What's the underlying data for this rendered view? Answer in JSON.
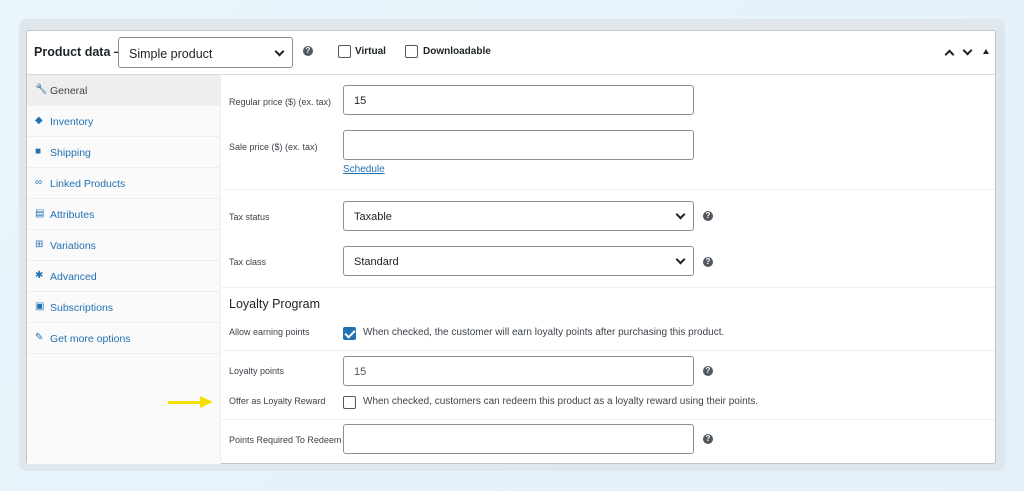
{
  "header": {
    "title": "Product data —",
    "product_type": "Simple product",
    "virtual_label": "Virtual",
    "virtual_checked": false,
    "downloadable_label": "Downloadable",
    "downloadable_checked": false
  },
  "sidebar": {
    "items": [
      {
        "label": "General",
        "icon": "wrench-icon",
        "glyph": "🔧",
        "active": true
      },
      {
        "label": "Inventory",
        "icon": "tag-icon",
        "glyph": "◆",
        "active": false
      },
      {
        "label": "Shipping",
        "icon": "truck-icon",
        "glyph": "■",
        "active": false
      },
      {
        "label": "Linked Products",
        "icon": "link-icon",
        "glyph": "∞",
        "active": false
      },
      {
        "label": "Attributes",
        "icon": "list-icon",
        "glyph": "▤",
        "active": false
      },
      {
        "label": "Variations",
        "icon": "grid-icon",
        "glyph": "⊞",
        "active": false
      },
      {
        "label": "Advanced",
        "icon": "gear-icon",
        "glyph": "✱",
        "active": false
      },
      {
        "label": "Subscriptions",
        "icon": "calendar-icon",
        "glyph": "▣",
        "active": false
      },
      {
        "label": "Get more options",
        "icon": "plugin-icon",
        "glyph": "✎",
        "active": false
      }
    ]
  },
  "general": {
    "regular_price_label": "Regular price ($) (ex. tax)",
    "regular_price_value": "15",
    "sale_price_label": "Sale price ($) (ex. tax)",
    "sale_price_value": "",
    "schedule_link": "Schedule",
    "tax_status_label": "Tax status",
    "tax_status_value": "Taxable",
    "tax_class_label": "Tax class",
    "tax_class_value": "Standard"
  },
  "loyalty": {
    "section_title": "Loyalty Program",
    "allow_earning_label": "Allow earning points",
    "allow_earning_checked": true,
    "allow_earning_desc": "When checked, the customer will earn loyalty points after purchasing this product.",
    "loyalty_points_label": "Loyalty points",
    "loyalty_points_placeholder": "15",
    "offer_reward_label": "Offer as Loyalty Reward",
    "offer_reward_checked": false,
    "offer_reward_desc": "When checked, customers can redeem this product as a loyalty reward using their points.",
    "points_required_label": "Points Required To Redeem",
    "points_required_value": ""
  },
  "colors": {
    "accent": "#2271b1",
    "highlight_arrow": "#f5e000"
  }
}
